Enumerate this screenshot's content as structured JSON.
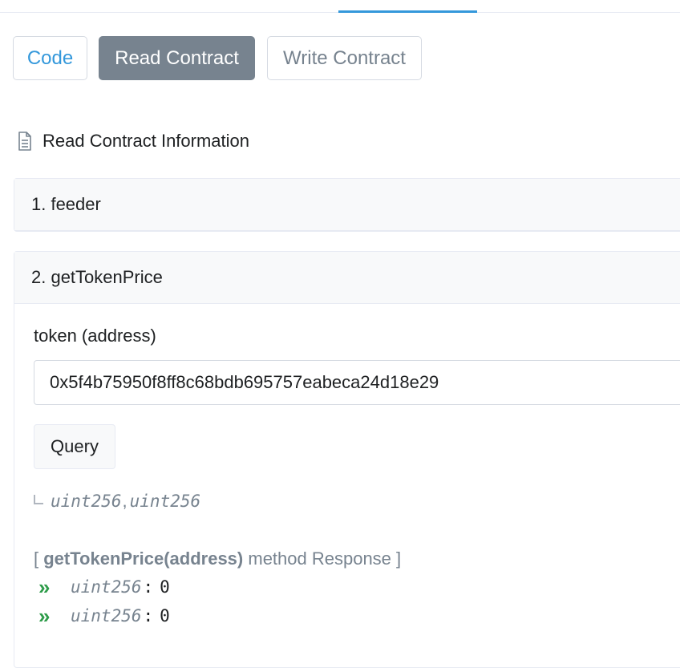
{
  "tabs": {
    "code": "Code",
    "read": "Read Contract",
    "write": "Write Contract"
  },
  "section": {
    "title": "Read Contract Information",
    "icon": "document-icon"
  },
  "functions": [
    {
      "label": "1. feeder"
    },
    {
      "label": "2. getTokenPrice"
    }
  ],
  "get_token_price": {
    "param_label": "token (address)",
    "param_value": "0x5f4b75950f8ff8c68bdb695757eabeca24d18e29",
    "query_label": "Query",
    "return_type_1": "uint256",
    "return_sep": ",",
    "return_type_2": "uint256",
    "response_open": "[ ",
    "response_method": "getTokenPrice(address)",
    "response_text": " method Response ]",
    "results": [
      {
        "arrow": "»",
        "type": "uint256",
        "colon": ":",
        "value": "0"
      },
      {
        "arrow": "»",
        "type": "uint256",
        "colon": ":",
        "value": "0"
      }
    ]
  },
  "colors": {
    "accent": "#3498db",
    "active_tab": "#77838f",
    "arrow": "#2e9c4a"
  }
}
